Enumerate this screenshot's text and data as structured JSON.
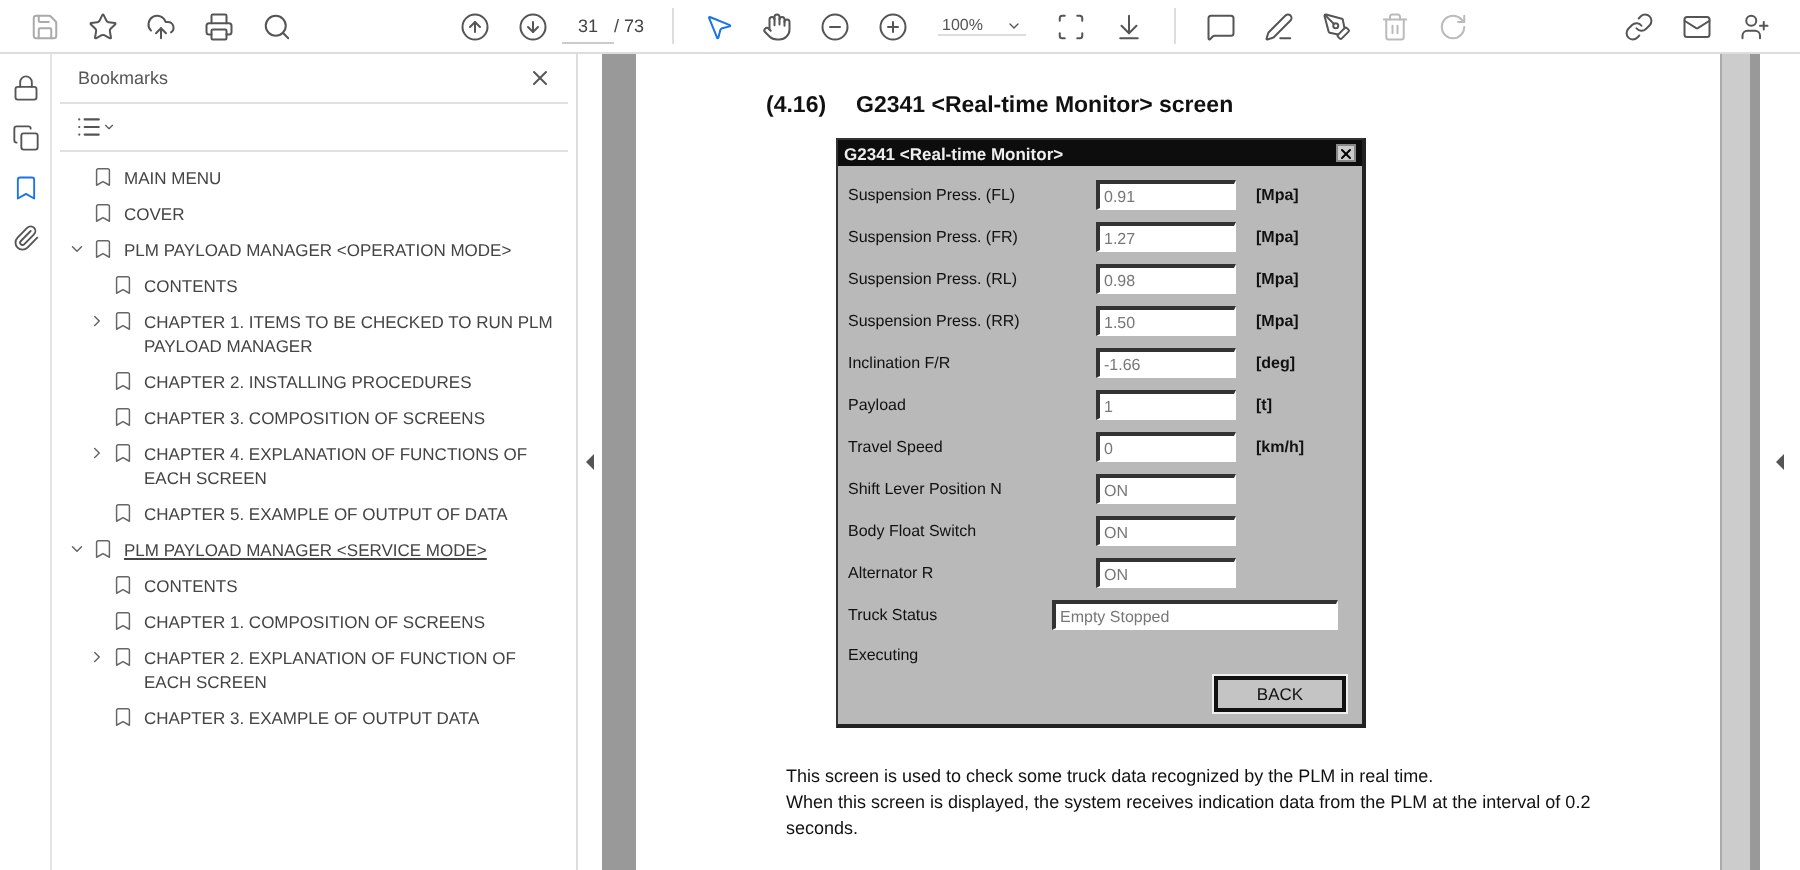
{
  "toolbar": {
    "page_number": "31",
    "page_total": "/ 73",
    "zoom": "100%"
  },
  "bookmarks": {
    "title": "Bookmarks",
    "items": [
      {
        "label": "MAIN MENU",
        "selected": false
      },
      {
        "label": "COVER",
        "selected": false
      },
      {
        "label": "PLM PAYLOAD MANAGER <OPERATION MODE>",
        "selected": false,
        "expanded": true,
        "children": [
          {
            "label": "CONTENTS",
            "selected": false
          },
          {
            "label": "CHAPTER 1. ITEMS TO BE CHECKED TO RUN PLM PAYLOAD MANAGER",
            "selected": false,
            "expanded": false
          },
          {
            "label": "CHAPTER 2. INSTALLING PROCEDURES",
            "selected": false
          },
          {
            "label": "CHAPTER 3. COMPOSITION OF SCREENS",
            "selected": false
          },
          {
            "label": "CHAPTER 4. EXPLANATION OF FUNCTIONS OF EACH SCREEN",
            "selected": false,
            "expanded": false
          },
          {
            "label": "CHAPTER 5. EXAMPLE OF OUTPUT OF DATA",
            "selected": false
          }
        ]
      },
      {
        "label": "PLM PAYLOAD MANAGER <SERVICE MODE>",
        "selected": true,
        "expanded": true,
        "children": [
          {
            "label": "CONTENTS",
            "selected": false
          },
          {
            "label": "CHAPTER 1. COMPOSITION OF SCREENS",
            "selected": false
          },
          {
            "label": "CHAPTER 2. EXPLANATION OF FUNCTION OF EACH SCREEN",
            "selected": false,
            "expanded": false
          },
          {
            "label": "CHAPTER 3. EXAMPLE OF OUTPUT DATA",
            "selected": false
          }
        ]
      }
    ]
  },
  "document": {
    "section_number": "(4.16)",
    "heading": "G2341 <Real-time Monitor> screen",
    "dialog": {
      "title": "G2341  <Real-time Monitor>",
      "rows": [
        {
          "kind": "field",
          "label": "Suspension Press. (FL)",
          "value": "0.91",
          "unit": "[Mpa]"
        },
        {
          "kind": "field",
          "label": "Suspension Press. (FR)",
          "value": "1.27",
          "unit": "[Mpa]"
        },
        {
          "kind": "field",
          "label": "Suspension Press. (RL)",
          "value": "0.98",
          "unit": "[Mpa]"
        },
        {
          "kind": "field",
          "label": "Suspension Press. (RR)",
          "value": "1.50",
          "unit": "[Mpa]"
        },
        {
          "kind": "field",
          "label": "Inclination F/R",
          "value": "-1.66",
          "unit": "[deg]"
        },
        {
          "kind": "field",
          "label": "Payload",
          "value": "1",
          "unit": "[t]"
        },
        {
          "kind": "field",
          "label": "Travel Speed",
          "value": "0",
          "unit": "[km/h]"
        },
        {
          "kind": "field",
          "label": "Shift Lever Position N",
          "value": "ON"
        },
        {
          "kind": "field",
          "label": "Body Float Switch",
          "value": "ON"
        },
        {
          "kind": "field",
          "label": "Alternator R",
          "value": "ON"
        },
        {
          "kind": "wide",
          "label": "Truck Status",
          "value": "Empty Stopped"
        },
        {
          "kind": "text",
          "label": "Executing"
        }
      ],
      "button": "BACK"
    },
    "paragraphs": [
      "This screen is used to check some truck data recognized by the PLM in real time.",
      "When this screen is displayed, the system receives indication data from the PLM at the interval of 0.2 seconds."
    ]
  }
}
